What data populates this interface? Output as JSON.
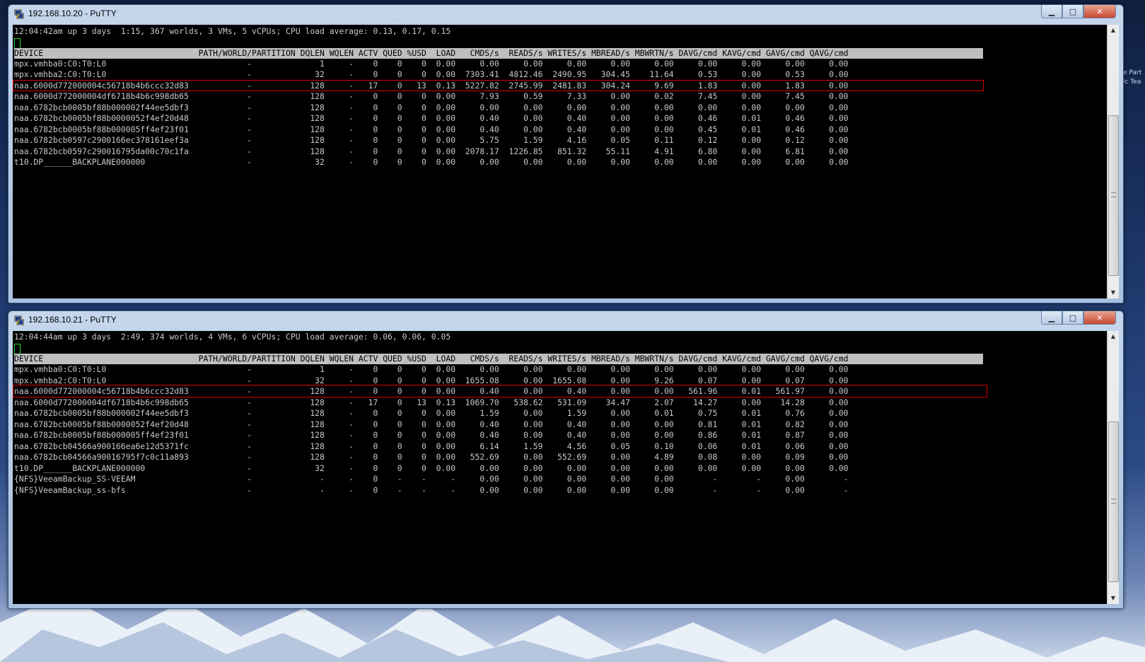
{
  "desktop": {
    "side_text_1": "e Part",
    "side_text_2": "ic Tea"
  },
  "windows": [
    {
      "title": "192.168.10.20 - PuTTY",
      "status_line": "12:04:42am up 3 days  1:15, 367 worlds, 3 VMs, 5 vCPUs; CPU load average: 0.13, 0.17, 0.15",
      "header": "DEVICE                                PATH/WORLD/PARTITION DQLEN WQLEN ACTV QUED %USD  LOAD   CMDS/s  READS/s WRITES/s MBREAD/s MBWRTN/s DAVG/cmd KAVG/cmd GAVG/cmd QAVG/cmd",
      "rows": [
        "mpx.vmhba0:C0:T0:L0                             -              1     -    0    0    0  0.00     0.00     0.00     0.00     0.00     0.00     0.00     0.00     0.00     0.00",
        "mpx.vmhba2:C0:T0:L0                             -             32     -    0    0    0  0.00  7303.41  4812.46  2490.95   304.45    11.64     0.53     0.00     0.53     0.00",
        "naa.6000d772000004c56718b4b6ccc32d83            -            128     -   17    0   13  0.13  5227.82  2745.99  2481.83   304.24     9.69     1.83     0.00     1.83     0.00",
        "naa.6000d772000004df6718b4b6c998db65            -            128     -    0    0    0  0.00     7.93     0.59     7.33     0.00     0.02     7.45     0.00     7.45     0.00",
        "naa.6782bcb0005bf88b000002f44ee5dbf3            -            128     -    0    0    0  0.00     0.00     0.00     0.00     0.00     0.00     0.00     0.00     0.00     0.00",
        "naa.6782bcb0005bf88b0000052f4ef20d48            -            128     -    0    0    0  0.00     0.40     0.00     0.40     0.00     0.00     0.46     0.01     0.46     0.00",
        "naa.6782bcb0005bf88b000005ff4ef23f01            -            128     -    0    0    0  0.00     0.40     0.00     0.40     0.00     0.00     0.45     0.01     0.46     0.00",
        "naa.6782bcb0597c2900166ec378161eef3a            -            128     -    0    0    0  0.00     5.75     1.59     4.16     0.05     0.11     0.12     0.00     0.12     0.00",
        "naa.6782bcb0597c290016795da00c70c1fa            -            128     -    0    0    0  0.00  2078.17  1226.85   851.32    55.11     4.91     6.80     0.00     6.81     0.00",
        "t10.DP______BACKPLANE000000                     -             32     -    0    0    0  0.00     0.00     0.00     0.00     0.00     0.00     0.00     0.00     0.00     0.00"
      ]
    },
    {
      "title": "192.168.10.21 - PuTTY",
      "status_line": "12:04:44am up 3 days  2:49, 374 worlds, 4 VMs, 6 vCPUs; CPU load average: 0.06, 0.06, 0.05",
      "header": "DEVICE                                PATH/WORLD/PARTITION DQLEN WQLEN ACTV QUED %USD  LOAD   CMDS/s  READS/s WRITES/s MBREAD/s MBWRTN/s DAVG/cmd KAVG/cmd GAVG/cmd QAVG/cmd",
      "rows": [
        "mpx.vmhba0:C0:T0:L0                             -              1     -    0    0    0  0.00     0.00     0.00     0.00     0.00     0.00     0.00     0.00     0.00     0.00",
        "mpx.vmhba2:C0:T0:L0                             -             32     -    0    0    0  0.00  1655.08     0.00  1655.08     0.00     9.26     0.07     0.00     0.07     0.00",
        "naa.6000d772000004c56718b4b6ccc32d83            -            128     -    0    0    0  0.00     0.40     0.00     0.40     0.00     0.00   561.96     0.01   561.97     0.00",
        "naa.6000d772000004df6718b4b6c998db65            -            128     -   17    0   13  0.13  1069.70   538.62   531.09    34.47     2.07    14.27     0.00    14.28     0.00",
        "naa.6782bcb0005bf88b000002f44ee5dbf3            -            128     -    0    0    0  0.00     1.59     0.00     1.59     0.00     0.01     0.75     0.01     0.76     0.00",
        "naa.6782bcb0005bf88b0000052f4ef20d48            -            128     -    0    0    0  0.00     0.40     0.00     0.40     0.00     0.00     0.81     0.01     0.82     0.00",
        "naa.6782bcb0005bf88b000005ff4ef23f01            -            128     -    0    0    0  0.00     0.40     0.00     0.40     0.00     0.00     0.86     0.01     0.87     0.00",
        "naa.6782bcb04566a900166ea6e12d5371fc            -            128     -    0    0    0  0.00     6.14     1.59     4.56     0.05     0.10     0.06     0.01     0.06     0.00",
        "naa.6782bcb04566a90016795f7c0c11a893            -            128     -    0    0    0  0.00   552.69     0.00   552.69     0.00     4.89     0.08     0.00     0.09     0.00",
        "t10.DP______BACKPLANE000000                     -             32     -    0    0    0  0.00     0.00     0.00     0.00     0.00     0.00     0.00     0.00     0.00     0.00",
        "{NFS}VeeamBackup_SS-VEEAM                       -              -     -    0    -    -     -     0.00     0.00     0.00     0.00     0.00        -        -     0.00        -",
        "{NFS}VeeamBackup_ss-bfs                         -              -     -    0    -    -     -     0.00     0.00     0.00     0.00     0.00        -        -     0.00        -"
      ]
    }
  ],
  "controls": {
    "minimize": "▁",
    "maximize": "□",
    "close": "✕"
  },
  "colors": {
    "highlight_box": "#e00000",
    "cursor": "#19d419",
    "terminal_bg": "#000000",
    "terminal_fg": "#c8c8c8",
    "header_bg": "#bfbfbf"
  }
}
